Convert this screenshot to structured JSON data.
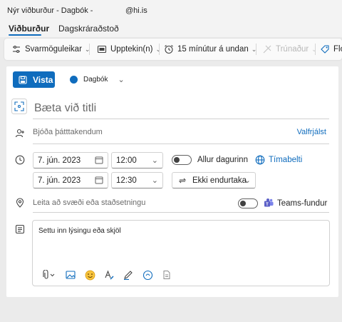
{
  "window": {
    "title": "Nýr viðburður - Dagbók -",
    "account": "@hi.is"
  },
  "tabs": [
    {
      "label": "Viðburður"
    },
    {
      "label": "Dagskráraðstoð"
    }
  ],
  "toolbar": {
    "response_options": "Svarmöguleikar",
    "busy": "Upptekin(n)",
    "reminder": "15 mínútur á undan",
    "private": "Trúnaður",
    "category": "Flo"
  },
  "actions": {
    "save_label": "Vista",
    "calendar_label": "Dagbók"
  },
  "form": {
    "title_placeholder": "Bæta við titli",
    "attendees_placeholder": "Bjóða þátttakendum",
    "optional_label": "Valfrjálst",
    "start_date": "7. jún. 2023",
    "start_time": "12:00",
    "end_date": "7. jún. 2023",
    "end_time": "12:30",
    "all_day_label": "Allur dagurinn",
    "timezone_label": "Tímabelti",
    "recurrence_label": "Ekki endurtaka",
    "location_placeholder": "Leita að svæði eða staðsetningu",
    "teams_label": "Teams-fundur",
    "description_placeholder": "Settu inn lýsingu eða skjöl"
  },
  "colors": {
    "accent": "#0f6cbd",
    "teams": "#5b5fc7"
  }
}
